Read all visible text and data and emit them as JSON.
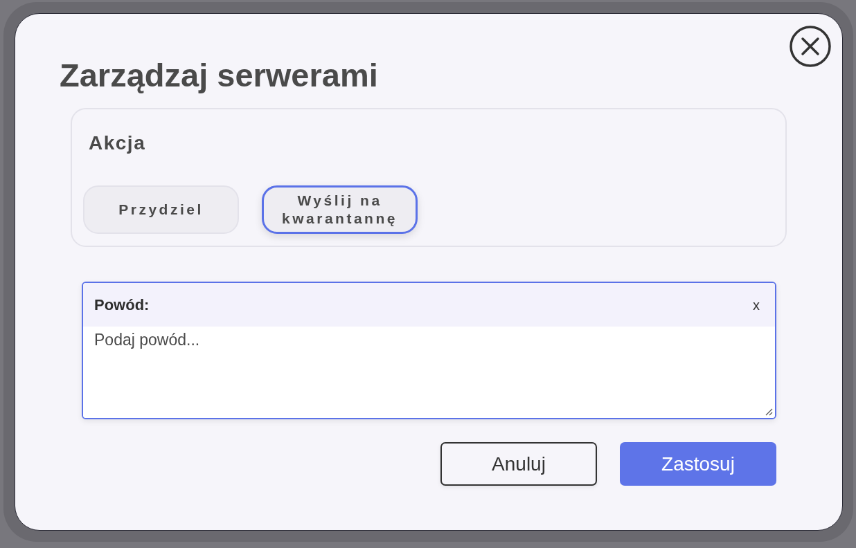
{
  "dialog": {
    "title": "Zarządzaj serwerami",
    "action_section": {
      "label": "Akcja",
      "options": [
        {
          "label": "Przydziel",
          "selected": false
        },
        {
          "label": "Wyślij na kwarantannę",
          "selected": true
        }
      ]
    },
    "reason": {
      "label": "Powód:",
      "clear_label": "x",
      "placeholder": "Podaj powód..."
    },
    "buttons": [
      {
        "label": "Anuluj",
        "kind": "secondary"
      },
      {
        "label": "Zastosuj",
        "kind": "primary"
      }
    ]
  }
}
